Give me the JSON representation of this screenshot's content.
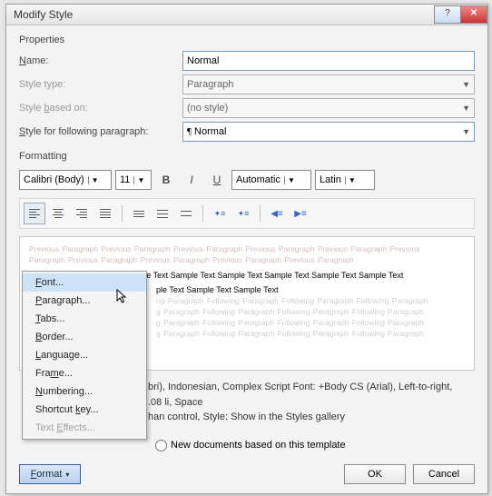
{
  "title": "Modify Style",
  "properties": {
    "heading": "Properties",
    "name_label": "Name:",
    "name_value": "Normal",
    "type_label": "Style type:",
    "type_value": "Paragraph",
    "based_label": "Style based on:",
    "based_value": "(no style)",
    "following_label": "Style for following paragraph:",
    "following_value": "Normal"
  },
  "formatting": {
    "heading": "Formatting",
    "font": "Calibri (Body)",
    "size": "11",
    "color": "Automatic",
    "script": "Latin"
  },
  "preview": {
    "grey1": "Previous Paragraph Previous Paragraph Previous Paragraph Previous Paragraph Previous Paragraph Previous",
    "grey2": "Paragraph Previous Paragraph Previous Paragraph Previous Paragraph Previous Paragraph",
    "sample1": "Sample Text Sample Text Sample Text Sample Text Sample Text Sample Text Sample Text Sample Text",
    "sample2_tail": "ple Text Sample Text Sample Text",
    "follow_tail1": "ng Paragraph Following Paragraph Following Paragraph Following Paragraph",
    "follow_tail2": "g Paragraph Following Paragraph Following Paragraph Following Paragraph",
    "follow_tail3": "g Paragraph Following Paragraph Following Paragraph Following Paragraph",
    "follow_tail4": "g Paragraph Following Paragraph Following Paragraph Following Paragraph"
  },
  "description": {
    "line1_tail": "bri), Indonesian, Complex Script Font: +Body CS (Arial), Left-to-right,",
    "line2_tail": ".08 li, Space",
    "line3_tail": "han control, Style: Show in the Styles gallery"
  },
  "radios": {
    "new_docs": "New documents based on this template"
  },
  "buttons": {
    "format": "Format",
    "ok": "OK",
    "cancel": "Cancel"
  },
  "menu": {
    "items": [
      "Font...",
      "Paragraph...",
      "Tabs...",
      "Border...",
      "Language...",
      "Frame...",
      "Numbering...",
      "Shortcut key...",
      "Text Effects..."
    ]
  }
}
